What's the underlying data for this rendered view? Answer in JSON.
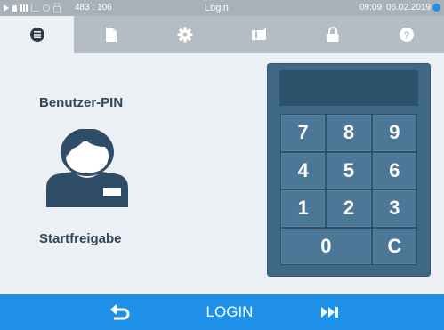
{
  "status": {
    "coords": "483 : 106",
    "title": "Login",
    "time": "09:09",
    "date": "06.02.2019",
    "alert_color": "#1e90e8"
  },
  "tabs": [
    {
      "icon": "menu-list-icon",
      "active": true
    },
    {
      "icon": "document-icon",
      "active": false
    },
    {
      "icon": "gear-icon",
      "active": false
    },
    {
      "icon": "info-card-icon",
      "active": false
    },
    {
      "icon": "lock-icon",
      "active": false
    },
    {
      "icon": "help-icon",
      "active": false
    }
  ],
  "main": {
    "pin_label": "Benutzer-PIN",
    "release_label": "Startfreigabe",
    "avatar_icon": "user-avatar-icon"
  },
  "keypad": {
    "display_value": "",
    "keys": [
      "7",
      "8",
      "9",
      "4",
      "5",
      "6",
      "1",
      "2",
      "3",
      "0",
      "C"
    ]
  },
  "bottom": {
    "back_icon": "back-arrow-icon",
    "title": "LOGIN",
    "skip_icon": "skip-forward-icon"
  },
  "colors": {
    "accent": "#1e90e8",
    "keypad": "#3f6885",
    "label_text": "#30475a"
  }
}
